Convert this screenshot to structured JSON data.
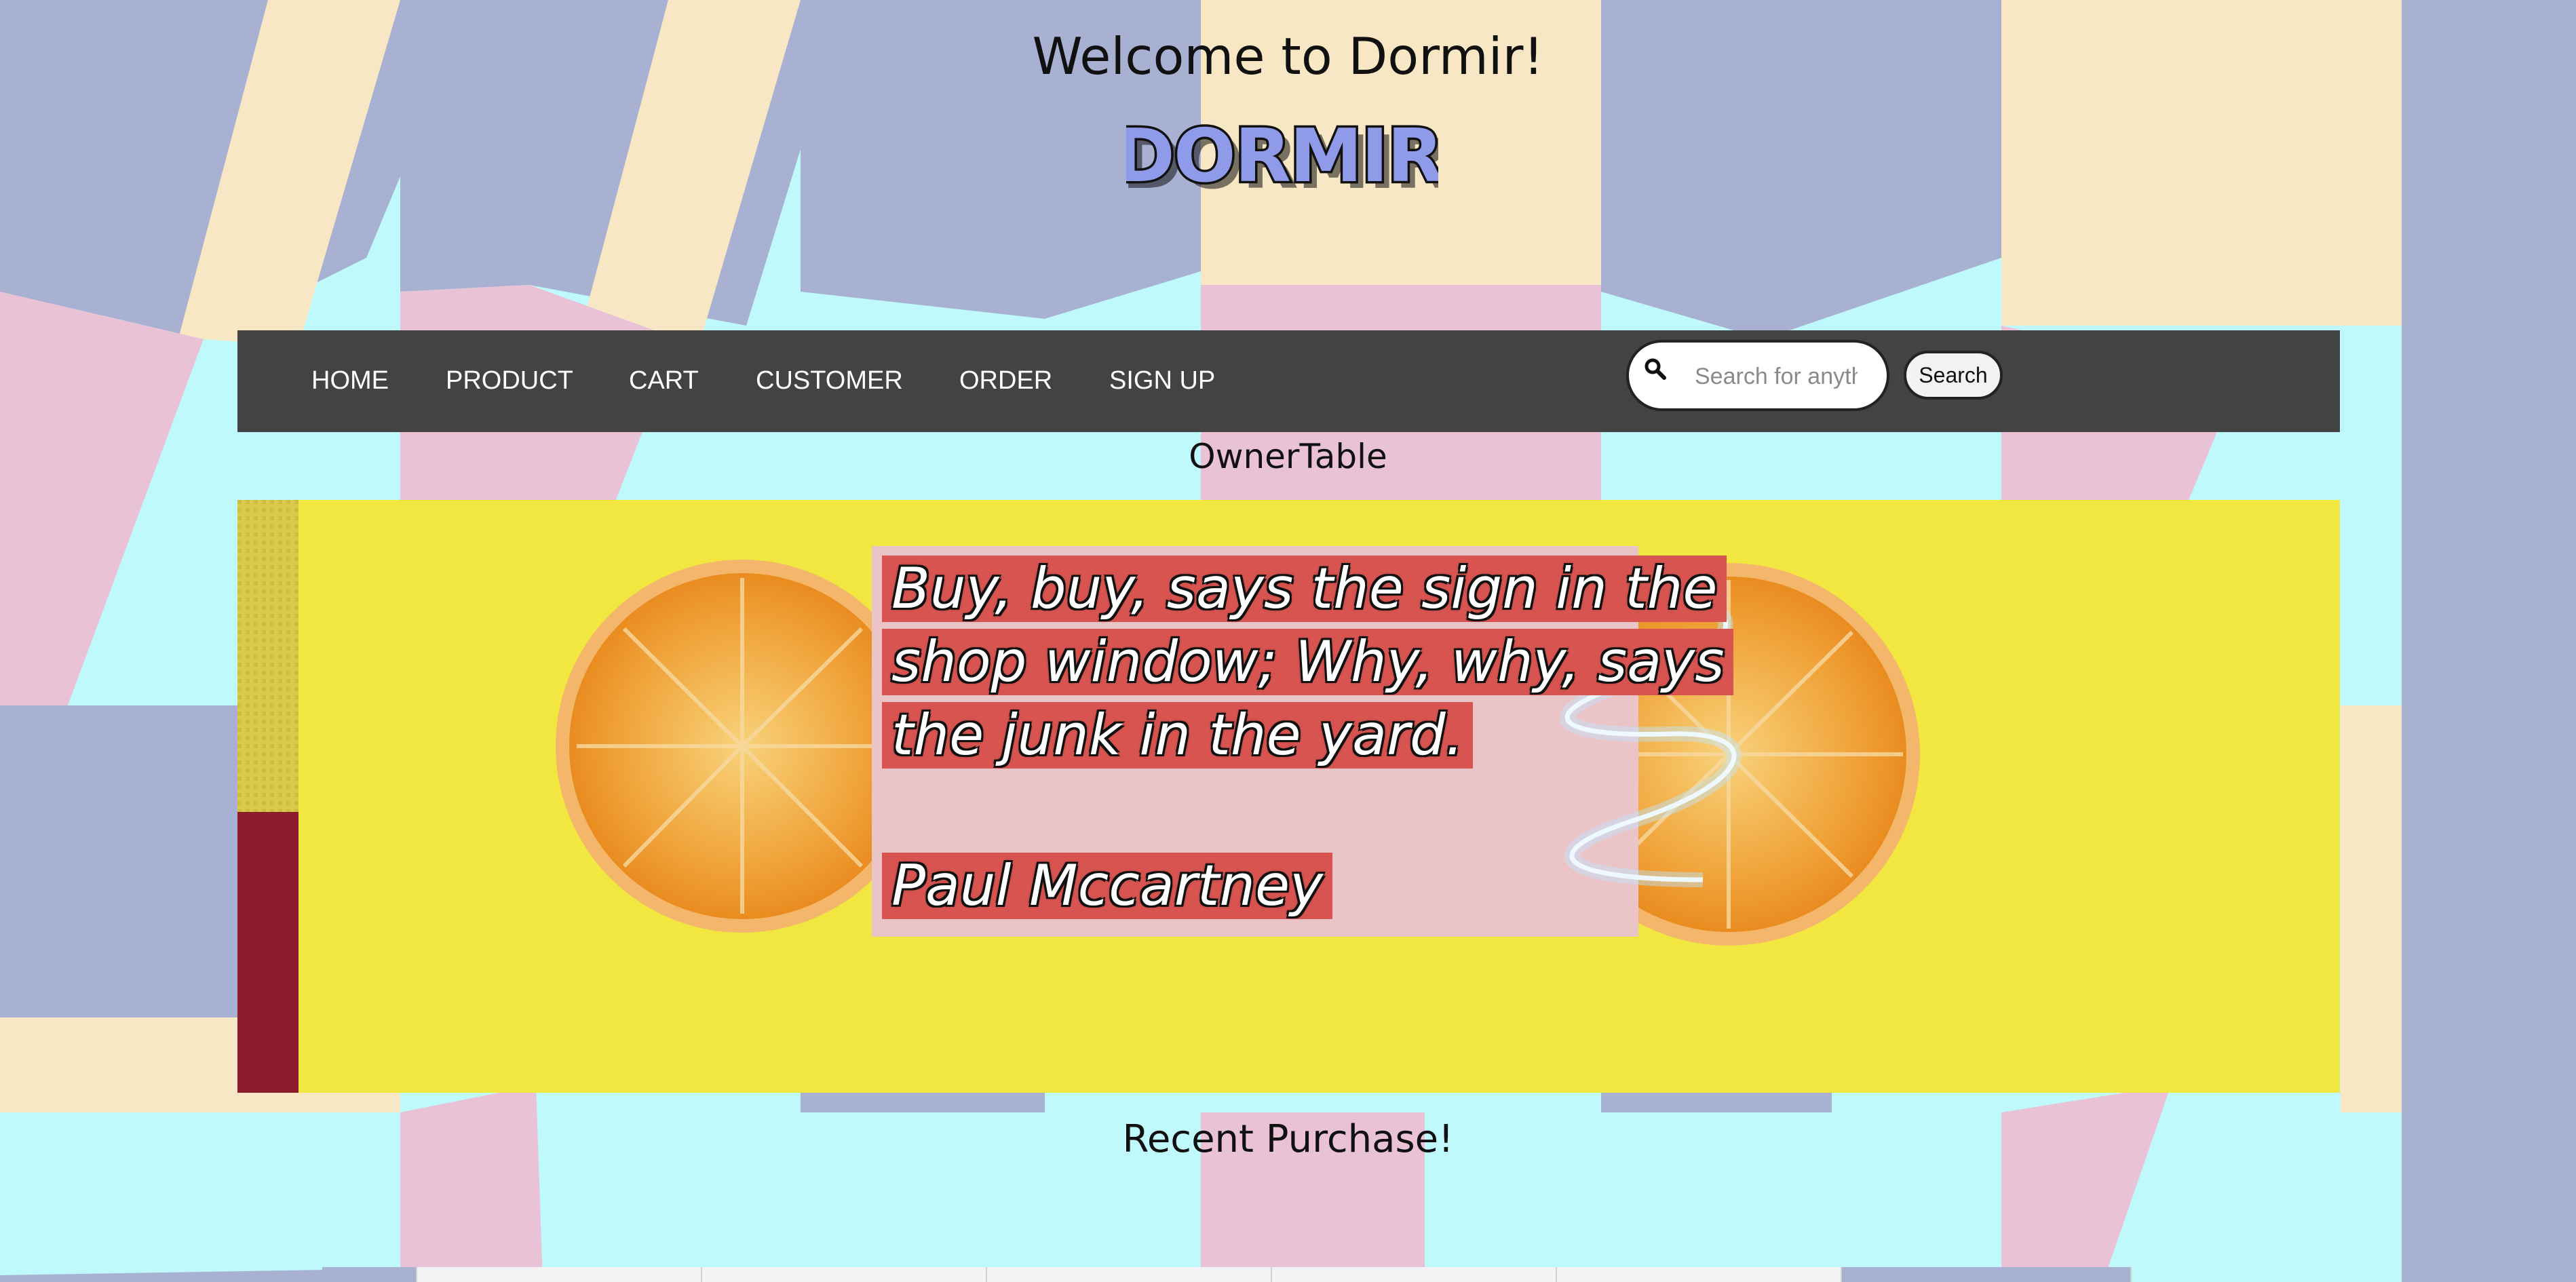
{
  "header": {
    "title": "Welcome to Dormir!",
    "logo_text": "DORMIR"
  },
  "navbar": {
    "items": [
      "HOME",
      "PRODUCT",
      "CART",
      "CUSTOMER",
      "ORDER",
      "SIGN UP"
    ],
    "search": {
      "placeholder": "Search for anything",
      "button_label": "Search",
      "icon": "search-icon"
    }
  },
  "main": {
    "section_title": "OwnerTable",
    "banner": {
      "quote_lines": [
        "Buy, buy, says the sign in the",
        "shop window; Why, why, says",
        "the junk in the yard."
      ],
      "author": "Paul Mccartney"
    },
    "recent_title": "Recent Purchase!"
  },
  "colors": {
    "navbar_bg": "#434343",
    "banner_bg": "#f2e640",
    "quote_highlight": "#d85450",
    "logo_fill": "#8f9be8"
  }
}
